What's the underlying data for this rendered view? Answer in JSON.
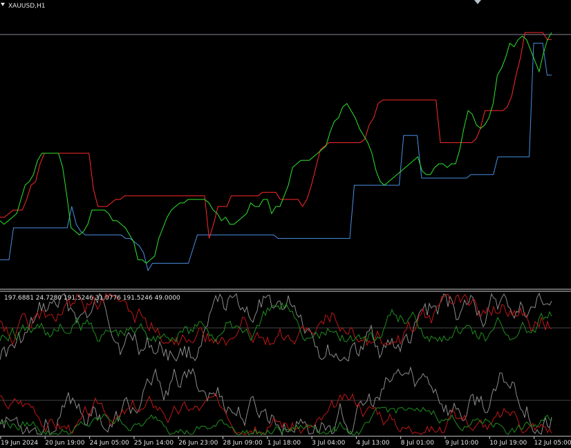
{
  "chart_data": {
    "type": "line",
    "symbol": "XAUUSD,H1",
    "indicator_readout": "197.6881 24.7280 191.5246 31.0776 191.5246 49.0000",
    "x_labels": [
      "19 Jun 2024",
      "20 Jun 19:00",
      "24 Jun 05:00",
      "25 Jun 14:00",
      "26 Jun 23:00",
      "28 Jun 09:00",
      "1 Jul 18:00",
      "3 Jul 04:00",
      "4 Jul 13:00",
      "8 Jul 01:00",
      "9 Jul 10:00",
      "10 Jul 19:00",
      "12 Jul 05:00"
    ],
    "series": [
      {
        "color": "#ff2a2a",
        "values": [
          12,
          12,
          13,
          14,
          14,
          14,
          17,
          21,
          22,
          27,
          30,
          30,
          30,
          30,
          30,
          30,
          30,
          30,
          30,
          30,
          30,
          20,
          15,
          15,
          15,
          16,
          17,
          17,
          18,
          18,
          18,
          18,
          18,
          18,
          18,
          18,
          18,
          18,
          18,
          18,
          18,
          18,
          18,
          18,
          18,
          18,
          18,
          6,
          10,
          15,
          15,
          15,
          18,
          18,
          18,
          18,
          18,
          18,
          18,
          19,
          19,
          19,
          19,
          17,
          17,
          17,
          17,
          17,
          15,
          17,
          21,
          26,
          31,
          32,
          33,
          33,
          33,
          33,
          33,
          33,
          33,
          33,
          34,
          38,
          40,
          44,
          45,
          45,
          45,
          45,
          45,
          45,
          45,
          45,
          45,
          45,
          45,
          45,
          45,
          33,
          33,
          33,
          33,
          33,
          33,
          33,
          33,
          34,
          37,
          42,
          42,
          42,
          42,
          42,
          43,
          46,
          52,
          57,
          64,
          64,
          64,
          64,
          64,
          62,
          62
        ]
      },
      {
        "color": "#4a90e2",
        "values": [
          0,
          0,
          0,
          9,
          9,
          9,
          9,
          9,
          9,
          9,
          9,
          9,
          9,
          9,
          9,
          9,
          15,
          10,
          8,
          7,
          7,
          7,
          7,
          7,
          7,
          7,
          7,
          7,
          6,
          6,
          5,
          4,
          2,
          -3,
          -1,
          -1,
          -1,
          -1,
          -1,
          -1,
          -1,
          -1,
          -1,
          3,
          7,
          7,
          7,
          7,
          7,
          7,
          7,
          7,
          7,
          7,
          7,
          7,
          7,
          7,
          7,
          7,
          7,
          7,
          6,
          6,
          6,
          6,
          6,
          6,
          6,
          6,
          6,
          6,
          6,
          6,
          6,
          6,
          6,
          6,
          6,
          21,
          21,
          21,
          21,
          21,
          21,
          21,
          21,
          21,
          21,
          21,
          35,
          35,
          35,
          35,
          23,
          23,
          23,
          23,
          23,
          23,
          23,
          23,
          23,
          23,
          23,
          24,
          24,
          24,
          24,
          24,
          24,
          29,
          29,
          29,
          29,
          29,
          29,
          29,
          29,
          61,
          61,
          61,
          52,
          52
        ]
      },
      {
        "color": "#2ee62e",
        "values": [
          11,
          10,
          11,
          12,
          13,
          17,
          21,
          22,
          24,
          28,
          30,
          30,
          30,
          30,
          30,
          26,
          18,
          9,
          8,
          7,
          8,
          10,
          14,
          14,
          14,
          14,
          13,
          11,
          11,
          10,
          9,
          7,
          5,
          0,
          0,
          -1,
          0,
          1,
          6,
          9,
          12,
          14,
          15,
          16,
          16,
          17,
          17,
          17,
          17,
          17,
          16,
          14,
          13,
          11,
          12,
          10,
          10,
          11,
          12,
          13,
          16,
          15,
          15,
          17,
          17,
          13,
          15,
          15,
          18,
          21,
          26,
          27,
          28,
          28,
          28,
          29,
          30,
          31,
          32,
          36,
          39,
          40,
          43,
          44,
          42,
          40,
          37,
          35,
          33,
          30,
          25,
          22,
          21,
          22,
          23,
          24,
          25,
          26,
          27,
          28,
          29,
          25,
          24,
          24,
          26,
          27,
          27,
          26,
          27,
          27,
          31,
          37,
          42,
          41,
          38,
          37,
          38,
          40,
          44,
          52,
          54,
          57,
          61,
          60,
          62,
          63,
          62,
          59,
          56,
          53,
          58,
          62,
          64
        ]
      }
    ]
  }
}
